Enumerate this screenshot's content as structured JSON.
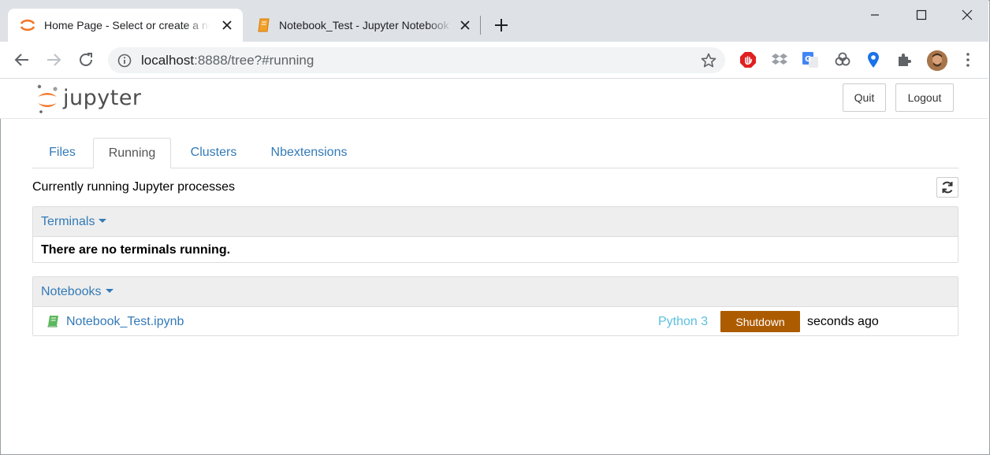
{
  "browser": {
    "tabs": [
      {
        "title": "Home Page - Select or create a notebook",
        "active": true
      },
      {
        "title": "Notebook_Test - Jupyter Notebook",
        "active": false
      }
    ],
    "url_host": "localhost",
    "url_rest": ":8888/tree?#running"
  },
  "jupyter": {
    "logo_text": "jupyter",
    "quit_label": "Quit",
    "logout_label": "Logout",
    "tabs": [
      {
        "label": "Files"
      },
      {
        "label": "Running"
      },
      {
        "label": "Clusters"
      },
      {
        "label": "Nbextensions"
      }
    ],
    "active_tab": "Running",
    "status": "Currently running Jupyter processes",
    "terminals": {
      "title": "Terminals",
      "empty_message": "There are no terminals running."
    },
    "notebooks": {
      "title": "Notebooks",
      "items": [
        {
          "name": "Notebook_Test.ipynb",
          "kernel": "Python 3",
          "action": "Shutdown",
          "time": "seconds ago"
        }
      ]
    }
  },
  "colors": {
    "link": "#337ab7",
    "kernel": "#5bc0de",
    "shutdown": "#ad5b00",
    "jupyter_orange": "#f37626"
  }
}
